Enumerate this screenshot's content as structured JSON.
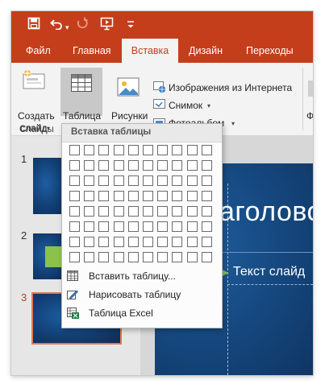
{
  "quick_access": {
    "save_icon": "save-icon",
    "undo_icon": "undo-icon",
    "redo_icon": "redo-icon",
    "present_icon": "start-from-beginning-icon",
    "customize_icon": "customize-toolbar-icon"
  },
  "tabs": [
    "Файл",
    "Главная",
    "Вставка",
    "Дизайн",
    "Переходы"
  ],
  "active_tab": "Вставка",
  "ribbon": {
    "new_slide_line1": "Создать",
    "new_slide_line2": "слайд",
    "table_label": "Таблица",
    "pictures_label": "Рисунки",
    "online_pictures": "Изображения из Интернета",
    "screenshot": "Снимок",
    "photo_album": "Фотоальбом",
    "slides_group": "Слайды",
    "partial_label": "Ф"
  },
  "dropdown": {
    "header": "Вставка таблицы",
    "grid_cols": 10,
    "grid_rows": 8,
    "items": [
      "Вставить таблицу...",
      "Нарисовать таблицу",
      "Таблица Excel"
    ]
  },
  "slides": {
    "numbers": [
      "1",
      "2",
      "3"
    ],
    "selected": "3"
  },
  "editor": {
    "title_partial": "аголовс",
    "text_partial": "Текст слайд"
  },
  "colors": {
    "accent": "#c43e1c",
    "slide_blue": "#164a82",
    "green_accent": "#8bc34a"
  }
}
